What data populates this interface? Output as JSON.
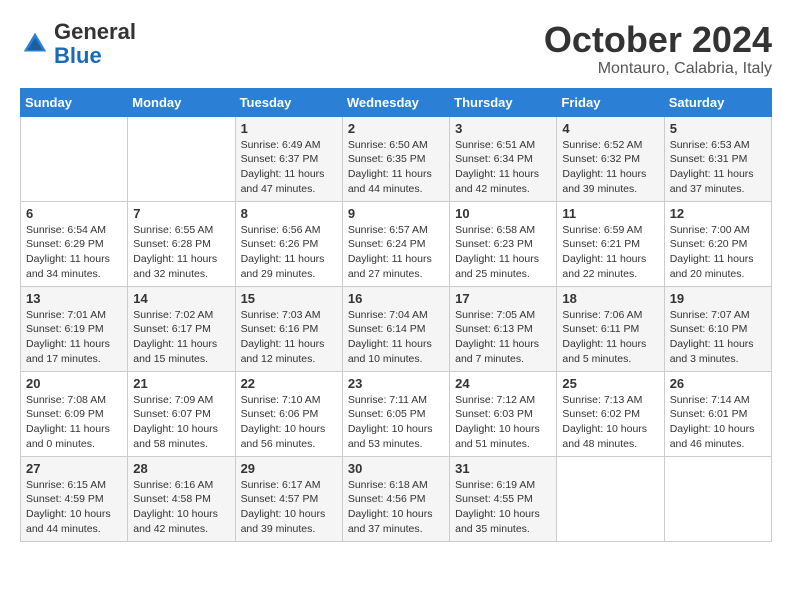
{
  "header": {
    "logo_general": "General",
    "logo_blue": "Blue",
    "month_title": "October 2024",
    "location": "Montauro, Calabria, Italy"
  },
  "days_of_week": [
    "Sunday",
    "Monday",
    "Tuesday",
    "Wednesday",
    "Thursday",
    "Friday",
    "Saturday"
  ],
  "weeks": [
    [
      {
        "day": "",
        "info": ""
      },
      {
        "day": "",
        "info": ""
      },
      {
        "day": "1",
        "info": "Sunrise: 6:49 AM\nSunset: 6:37 PM\nDaylight: 11 hours and 47 minutes."
      },
      {
        "day": "2",
        "info": "Sunrise: 6:50 AM\nSunset: 6:35 PM\nDaylight: 11 hours and 44 minutes."
      },
      {
        "day": "3",
        "info": "Sunrise: 6:51 AM\nSunset: 6:34 PM\nDaylight: 11 hours and 42 minutes."
      },
      {
        "day": "4",
        "info": "Sunrise: 6:52 AM\nSunset: 6:32 PM\nDaylight: 11 hours and 39 minutes."
      },
      {
        "day": "5",
        "info": "Sunrise: 6:53 AM\nSunset: 6:31 PM\nDaylight: 11 hours and 37 minutes."
      }
    ],
    [
      {
        "day": "6",
        "info": "Sunrise: 6:54 AM\nSunset: 6:29 PM\nDaylight: 11 hours and 34 minutes."
      },
      {
        "day": "7",
        "info": "Sunrise: 6:55 AM\nSunset: 6:28 PM\nDaylight: 11 hours and 32 minutes."
      },
      {
        "day": "8",
        "info": "Sunrise: 6:56 AM\nSunset: 6:26 PM\nDaylight: 11 hours and 29 minutes."
      },
      {
        "day": "9",
        "info": "Sunrise: 6:57 AM\nSunset: 6:24 PM\nDaylight: 11 hours and 27 minutes."
      },
      {
        "day": "10",
        "info": "Sunrise: 6:58 AM\nSunset: 6:23 PM\nDaylight: 11 hours and 25 minutes."
      },
      {
        "day": "11",
        "info": "Sunrise: 6:59 AM\nSunset: 6:21 PM\nDaylight: 11 hours and 22 minutes."
      },
      {
        "day": "12",
        "info": "Sunrise: 7:00 AM\nSunset: 6:20 PM\nDaylight: 11 hours and 20 minutes."
      }
    ],
    [
      {
        "day": "13",
        "info": "Sunrise: 7:01 AM\nSunset: 6:19 PM\nDaylight: 11 hours and 17 minutes."
      },
      {
        "day": "14",
        "info": "Sunrise: 7:02 AM\nSunset: 6:17 PM\nDaylight: 11 hours and 15 minutes."
      },
      {
        "day": "15",
        "info": "Sunrise: 7:03 AM\nSunset: 6:16 PM\nDaylight: 11 hours and 12 minutes."
      },
      {
        "day": "16",
        "info": "Sunrise: 7:04 AM\nSunset: 6:14 PM\nDaylight: 11 hours and 10 minutes."
      },
      {
        "day": "17",
        "info": "Sunrise: 7:05 AM\nSunset: 6:13 PM\nDaylight: 11 hours and 7 minutes."
      },
      {
        "day": "18",
        "info": "Sunrise: 7:06 AM\nSunset: 6:11 PM\nDaylight: 11 hours and 5 minutes."
      },
      {
        "day": "19",
        "info": "Sunrise: 7:07 AM\nSunset: 6:10 PM\nDaylight: 11 hours and 3 minutes."
      }
    ],
    [
      {
        "day": "20",
        "info": "Sunrise: 7:08 AM\nSunset: 6:09 PM\nDaylight: 11 hours and 0 minutes."
      },
      {
        "day": "21",
        "info": "Sunrise: 7:09 AM\nSunset: 6:07 PM\nDaylight: 10 hours and 58 minutes."
      },
      {
        "day": "22",
        "info": "Sunrise: 7:10 AM\nSunset: 6:06 PM\nDaylight: 10 hours and 56 minutes."
      },
      {
        "day": "23",
        "info": "Sunrise: 7:11 AM\nSunset: 6:05 PM\nDaylight: 10 hours and 53 minutes."
      },
      {
        "day": "24",
        "info": "Sunrise: 7:12 AM\nSunset: 6:03 PM\nDaylight: 10 hours and 51 minutes."
      },
      {
        "day": "25",
        "info": "Sunrise: 7:13 AM\nSunset: 6:02 PM\nDaylight: 10 hours and 48 minutes."
      },
      {
        "day": "26",
        "info": "Sunrise: 7:14 AM\nSunset: 6:01 PM\nDaylight: 10 hours and 46 minutes."
      }
    ],
    [
      {
        "day": "27",
        "info": "Sunrise: 6:15 AM\nSunset: 4:59 PM\nDaylight: 10 hours and 44 minutes."
      },
      {
        "day": "28",
        "info": "Sunrise: 6:16 AM\nSunset: 4:58 PM\nDaylight: 10 hours and 42 minutes."
      },
      {
        "day": "29",
        "info": "Sunrise: 6:17 AM\nSunset: 4:57 PM\nDaylight: 10 hours and 39 minutes."
      },
      {
        "day": "30",
        "info": "Sunrise: 6:18 AM\nSunset: 4:56 PM\nDaylight: 10 hours and 37 minutes."
      },
      {
        "day": "31",
        "info": "Sunrise: 6:19 AM\nSunset: 4:55 PM\nDaylight: 10 hours and 35 minutes."
      },
      {
        "day": "",
        "info": ""
      },
      {
        "day": "",
        "info": ""
      }
    ]
  ]
}
